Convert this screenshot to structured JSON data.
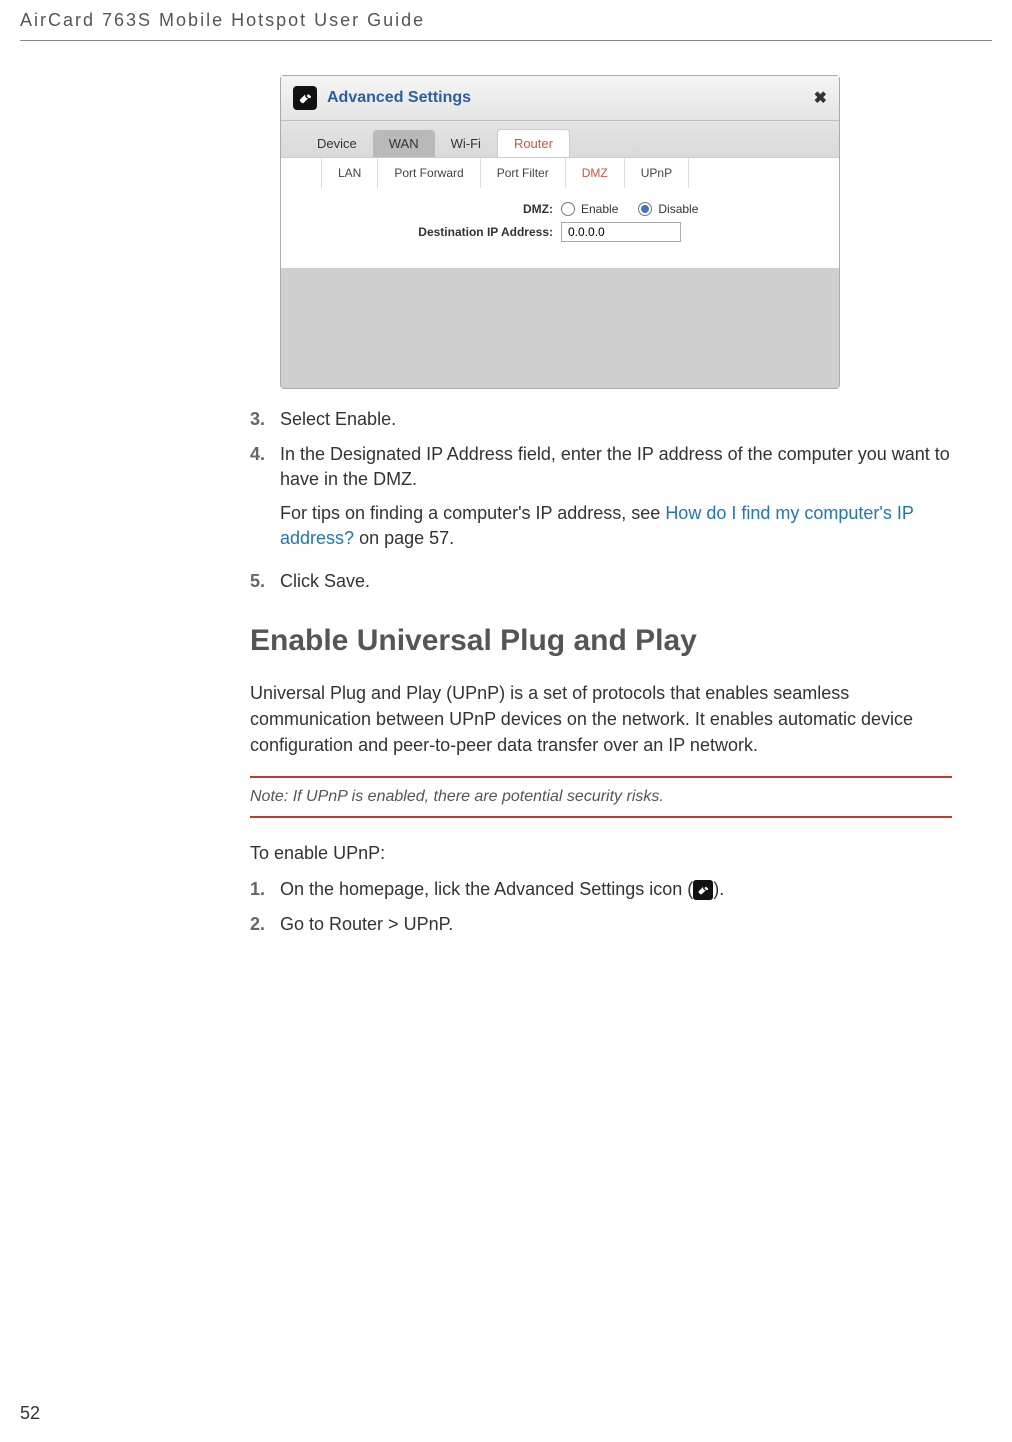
{
  "header": {
    "title": "AirCard 763S Mobile Hotspot User Guide"
  },
  "screenshot": {
    "titlebar": {
      "title": "Advanced Settings"
    },
    "main_tabs": {
      "device": "Device",
      "wan": "WAN",
      "wifi": "Wi-Fi",
      "router": "Router"
    },
    "sub_tabs": {
      "lan": "LAN",
      "port_forward": "Port Forward",
      "port_filter": "Port Filter",
      "dmz": "DMZ",
      "upnp": "UPnP"
    },
    "form": {
      "dmz_label": "DMZ:",
      "enable_label": "Enable",
      "disable_label": "Disable",
      "dest_label": "Destination IP Address:",
      "dest_value": "0.0.0.0"
    }
  },
  "steps_a": {
    "s3": {
      "num": "3.",
      "text": "Select Enable."
    },
    "s4": {
      "num": "4.",
      "text1": "In the Designated IP Address field, enter the IP address of the computer you want to have in the DMZ.",
      "text2_pre": "For tips on finding a computer's IP address, see ",
      "text2_link": "How do I find my computer's IP address?",
      "text2_post": " on page 57."
    },
    "s5": {
      "num": "5.",
      "text": "Click Save."
    }
  },
  "section_title": "Enable Universal Plug and Play",
  "paragraph": "Universal Plug and Play (UPnP) is a set of protocols that enables seamless communication between UPnP devices on the network. It enables automatic device configuration and peer-to-peer data transfer over an IP network.",
  "note": {
    "label": "Note: ",
    "text": "If UPnP is enabled, there are potential security risks."
  },
  "enable_intro": "To enable UPnP:",
  "steps_b": {
    "s1": {
      "num": "1.",
      "pre": "On the homepage, lick the Advanced Settings icon (",
      "post": ")."
    },
    "s2": {
      "num": "2.",
      "text": "Go to Router > UPnP."
    }
  },
  "page_number": "52"
}
